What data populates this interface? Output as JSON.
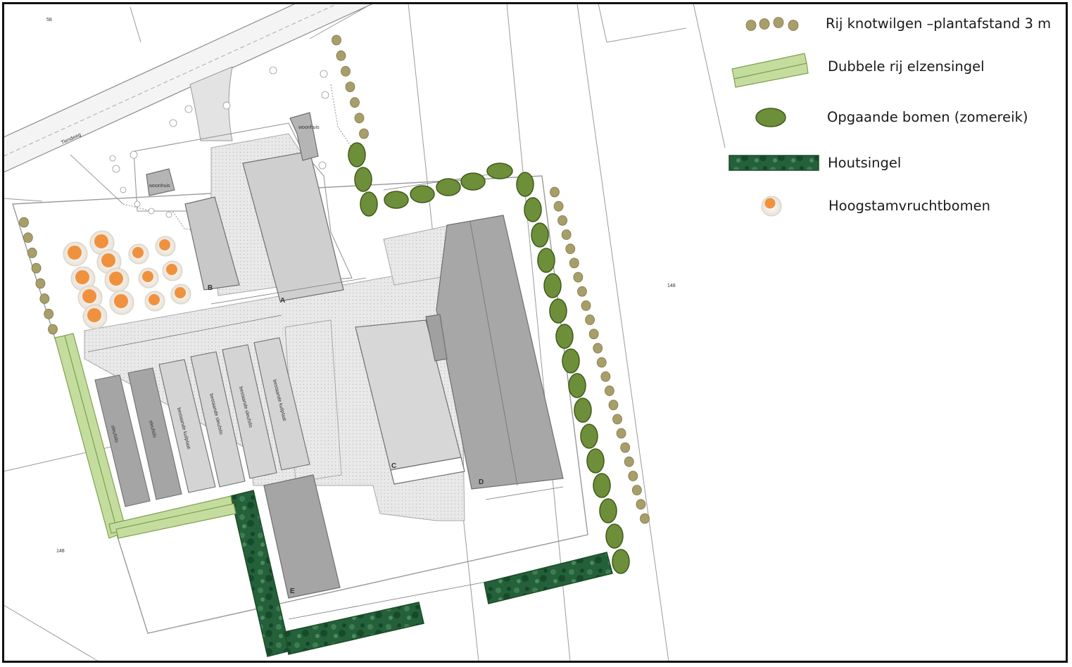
{
  "legend": {
    "knotwilgen": "Rij knotwilgen –plantafstand 3 m",
    "elzensingel": "Dubbele rij elzensingel",
    "zomereik": "Opgaande bomen (zomereik)",
    "houtsingel": "Houtsingel",
    "hoogstam": "Hoogstamvruchtbomen"
  },
  "map": {
    "road_name": "Tiendweg",
    "buildings": {
      "a": "A",
      "b": "B",
      "c": "C",
      "d": "D",
      "e": "E",
      "woonhuis_1": "woonhuis",
      "woonhuis_2": "woonhuis",
      "sleufsilo_1": "sleufsilo",
      "sleufsilo_2": "sleufsilo",
      "kuilplaat_1": "bestaande kuilplaat",
      "sleufsilo_3": "bestaande sleufsilo",
      "sleufsilo_4": "bestaande sleufsilo",
      "kuilplaat_2": "bestaande kuilplaat"
    },
    "parcel_numbers": [
      "148",
      "148",
      "58"
    ]
  },
  "colors": {
    "knotwilg": "#a89e6a",
    "elzensingel": "#c3dc9c",
    "zomereik": "#6e8f3a",
    "houtsingel": "#1f5a2c",
    "fruit_outer": "#f2ede6",
    "fruit_inner": "#f0913e",
    "building_dark": "#a3a3a3",
    "building_light": "#d4d4d4",
    "paving": "#e6e6e6"
  }
}
